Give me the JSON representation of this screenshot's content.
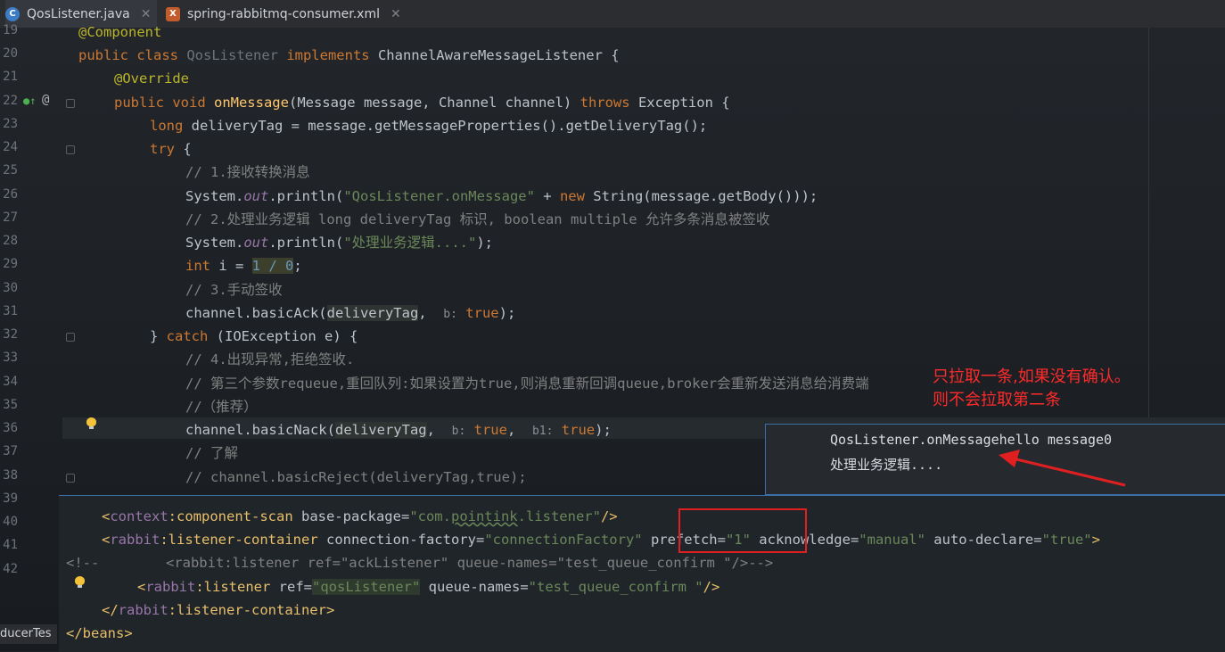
{
  "tabs": [
    {
      "label": "QosListener.java",
      "icon": "C"
    },
    {
      "label": "spring-rabbitmq-consumer.xml",
      "icon": "X"
    }
  ],
  "line_numbers": [
    "19",
    "20",
    "21",
    "22",
    "23",
    "24",
    "25",
    "26",
    "27",
    "28",
    "29",
    "30",
    "31",
    "32",
    "33",
    "34",
    "35",
    "36",
    "37",
    "38",
    "39",
    "40",
    "41",
    "42"
  ],
  "java": {
    "l19": "@Component",
    "l20_a": "public class ",
    "l20_b": "QosListener",
    "l20_c": " implements ",
    "l20_d": "ChannelAwareMessageListener {",
    "l21": "@Override",
    "l22_a": "public void ",
    "l22_b": "onMessage",
    "l22_c": "(Message message, Channel channel) ",
    "l22_d": "throws",
    "l22_e": " Exception {",
    "l23_a": "long",
    "l23_b": " deliveryTag = message.getMessageProperties().getDeliveryTag();",
    "l24_a": "try",
    "l24_b": " {",
    "l25": "// 1.接收转换消息",
    "l26_a": "System.",
    "l26_b": "out",
    "l26_c": ".println(",
    "l26_d": "\"QosListener.onMessage\"",
    "l26_e": " + ",
    "l26_f": "new",
    "l26_g": " String(message.getBody()));",
    "l27": "// 2.处理业务逻辑 long deliveryTag 标识, boolean multiple 允许多条消息被签收",
    "l28_a": "System.",
    "l28_b": "out",
    "l28_c": ".println(",
    "l28_d": "\"处理业务逻辑....\"",
    "l28_e": ");",
    "l29_a": "int",
    "l29_b": " i = ",
    "l29_c": "1 / 0",
    "l29_d": ";",
    "l30": "// 3.手动签收",
    "l31_a": "channel.basicAck(",
    "l31_b": "deliveryTag",
    "l31_c": ",  ",
    "l31_d": "b:",
    "l31_e": " true",
    "l31_f": ");",
    "l32_a": "} ",
    "l32_b": "catch",
    "l32_c": " (IOException e) {",
    "l33": "// 4.出现异常,拒绝签收.",
    "l34": "// 第三个参数requeue,重回队列:如果设置为true,则消息重新回调queue,broker会重新发送消息给消费端",
    "l35": "//（推荐）",
    "l36_a": "channel.basicNack(",
    "l36_b": "deliveryTag",
    "l36_c": ",  ",
    "l36_d": "b:",
    "l36_e": " true",
    "l36_f": ",  ",
    "l36_g": "b1:",
    "l36_h": " true",
    "l36_i": ");",
    "l37": "// 了解",
    "l38": "// channel.basicReject(deliveryTag,true);"
  },
  "console": {
    "line1": "QosListener.onMessagehello message0",
    "line2": "处理业务逻辑...."
  },
  "xml": {
    "x1_a": "<",
    "x1_b": "context",
    "x1_c": ":component-scan ",
    "x1_d": "base-package",
    "x1_e": "=",
    "x1_f": "\"com.",
    "x1_g": "pointink",
    "x1_h": ".listener\"",
    "x1_i": "/>",
    "x2_a": "<",
    "x2_b": "rabbit",
    "x2_c": ":listener-container ",
    "x2_d": "connection-factory",
    "x2_e": "=",
    "x2_f": "\"connectionFactory\"",
    "x2_g": " prefetch",
    "x2_h": "=",
    "x2_i": "\"1\"",
    "x2_j": " acknowledge",
    "x2_k": "=",
    "x2_l": "\"manual\"",
    "x2_m": " auto-declare",
    "x2_n": "=",
    "x2_o": "\"true\"",
    "x2_p": ">",
    "x3": "<!--        <rabbit:listener ref=\"ackListener\" queue-names=\"test_queue_confirm \"/>-->",
    "x4_a": "<",
    "x4_b": "rabbit",
    "x4_c": ":listener ",
    "x4_d": "ref",
    "x4_e": "=",
    "x4_f": "\"qosListener\"",
    "x4_g": " queue-names",
    "x4_h": "=",
    "x4_i": "\"test_queue_confirm \"",
    "x4_j": "/>",
    "x5_a": "</",
    "x5_b": "rabbit",
    "x5_c": ":listener-container>",
    "x6": "</beans>"
  },
  "annotation": {
    "line1": "只拉取一条,如果没有确认。",
    "line2": "则不会拉取第二条"
  },
  "side_tab_label": "ducerTes",
  "colors": {
    "annotation_red": "#e02020",
    "tab_accent": "#4a88c7"
  }
}
